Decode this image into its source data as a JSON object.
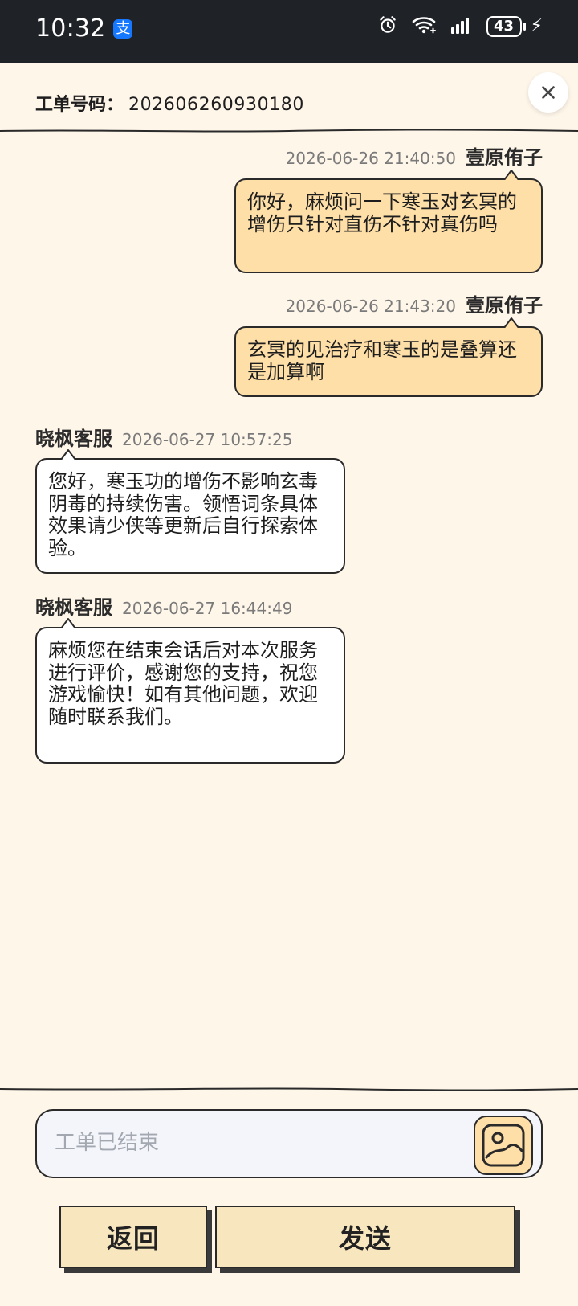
{
  "status_bar": {
    "time": "10:32",
    "alipay_icon_text": "支",
    "battery": "43",
    "icons": [
      "alarm-icon",
      "wifi-icon",
      "signal-icon",
      "battery-icon",
      "charging-icon"
    ]
  },
  "header": {
    "ticket_label": "工单号码：",
    "ticket_number": "202606260930180",
    "close_icon": "close-icon"
  },
  "messages": [
    {
      "sender": "壹原侑子",
      "time": "2026-06-26 21:40:50",
      "text": "你好，麻烦问一下寒玉对玄冥的增伤只针对直伤不针对真伤吗"
    },
    {
      "sender": "壹原侑子",
      "time": "2026-06-26 21:43:20",
      "text": "玄冥的见治疗和寒玉的是叠算还是加算啊"
    },
    {
      "sender": "晓枫客服",
      "time": "2026-06-27 10:57:25",
      "text": "您好，寒玉功的增伤不影响玄毒阴毒的持续伤害。领悟词条具体效果请少侠等更新后自行探索体验。"
    },
    {
      "sender": "晓枫客服",
      "time": "2026-06-27 16:44:49",
      "text": "麻烦您在结束会话后对本次服务进行评价，感谢您的支持，祝您游戏愉快！如有其他问题，欢迎随时联系我们。"
    }
  ],
  "composer": {
    "placeholder": "工单已结束",
    "image_icon": "image-icon"
  },
  "actions": {
    "back": "返回",
    "send": "发送"
  },
  "colors": {
    "background": "#FFF6EA",
    "status_bar": "#1F2328",
    "user_bubble": "#FFDFA8",
    "service_bubble": "#FFFFFF",
    "button": "#F8E7BE",
    "input": "#F3F5FB"
  }
}
